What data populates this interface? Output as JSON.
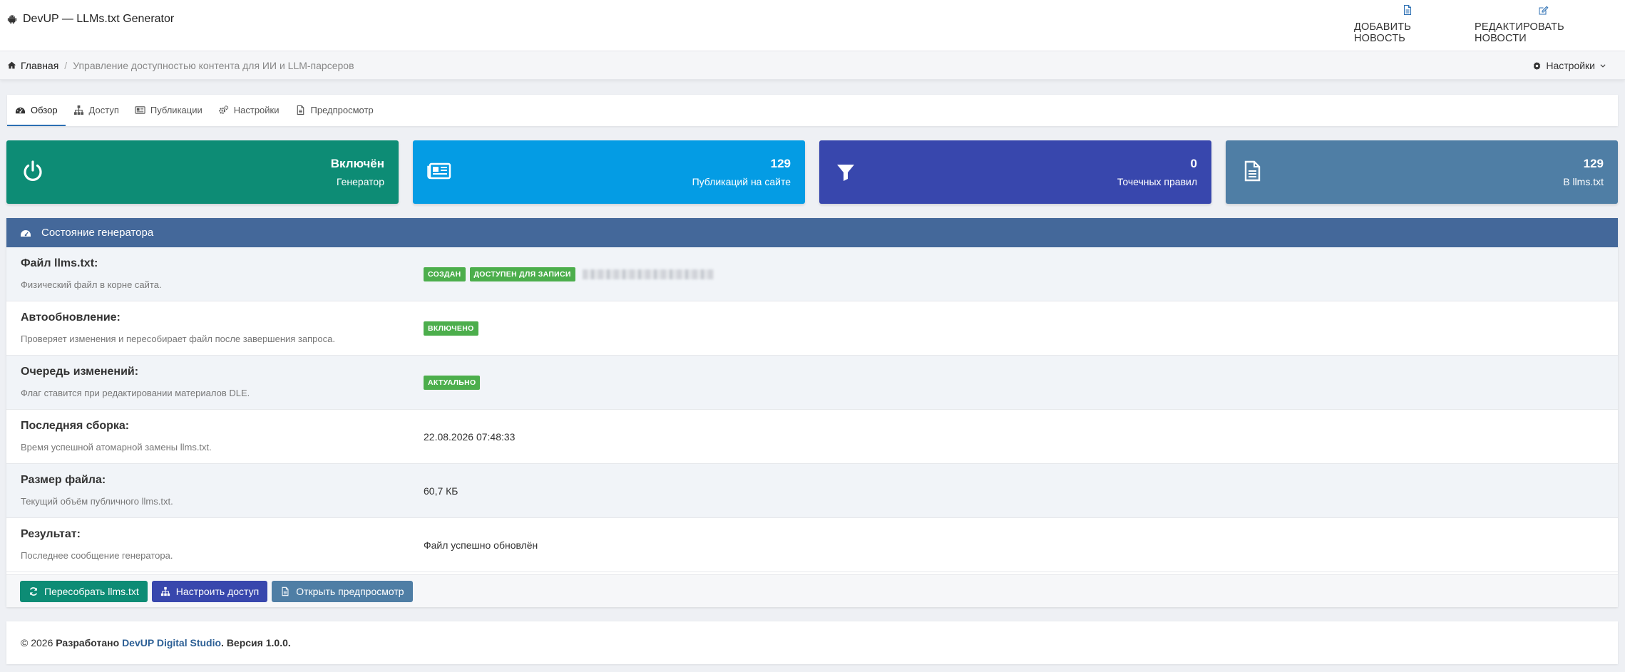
{
  "header": {
    "title": "DevUP — LLMs.txt Generator",
    "add_news": "Добавить новость",
    "edit_news": "Редактировать новости"
  },
  "breadcrumbs": {
    "home": "Главная",
    "separator": "/",
    "current": "Управление доступностью контента для ИИ и LLM-парсеров",
    "settings": "Настройки"
  },
  "tabs": [
    {
      "label": "Обзор",
      "icon": "dashboard-icon",
      "active": true
    },
    {
      "label": "Доступ",
      "icon": "sitemap-icon"
    },
    {
      "label": "Публикации",
      "icon": "newspaper-icon"
    },
    {
      "label": "Настройки",
      "icon": "cogs-icon"
    },
    {
      "label": "Предпросмотр",
      "icon": "file-icon"
    }
  ],
  "stats": [
    {
      "value": "Включён",
      "label": "Генератор",
      "icon": "power-icon",
      "color": "#0d8c75"
    },
    {
      "value": "129",
      "label": "Публикаций на сайте",
      "icon": "newspaper-icon",
      "color": "#049ce4"
    },
    {
      "value": "0",
      "label": "Точечных правил",
      "icon": "filter-icon",
      "color": "#3847ad"
    },
    {
      "value": "129",
      "label": "В llms.txt",
      "icon": "file-icon",
      "color": "#4f7ea5"
    }
  ],
  "panel": {
    "title": "Состояние генератора",
    "rows": [
      {
        "title": "Файл llms.txt:",
        "desc": "Физический файл в корне сайта.",
        "badges": [
          "Создан",
          "Доступен для записи"
        ]
      },
      {
        "title": "Автообновление:",
        "desc": "Проверяет изменения и пересобирает файл после завершения запроса.",
        "badges": [
          "Включено"
        ]
      },
      {
        "title": "Очередь изменений:",
        "desc": "Флаг ставится при редактировании материалов DLE.",
        "badges": [
          "Актуально"
        ]
      },
      {
        "title": "Последняя сборка:",
        "desc": "Время успешной атомарной замены llms.txt.",
        "value": "22.08.2026 07:48:33"
      },
      {
        "title": "Размер файла:",
        "desc": "Текущий объём публичного llms.txt.",
        "value": "60,7 КБ"
      },
      {
        "title": "Результат:",
        "desc": "Последнее сообщение генератора.",
        "value": "Файл успешно обновлён"
      }
    ],
    "buttons": {
      "rebuild": "Пересобрать llms.txt",
      "access": "Настроить доступ",
      "preview": "Открыть предпросмотр"
    }
  },
  "footer": {
    "copyright": "© 2026",
    "developed": "Разработано",
    "studio": "DevUP Digital Studio",
    "version": ". Версия 1.0.0."
  },
  "colors": {
    "accent_green": "#0d8c75",
    "accent_blue": "#049ce4",
    "accent_indigo": "#3847ad",
    "accent_steel": "#4f7ea5",
    "panel_header": "#44689a",
    "badge_green": "#4cae4c"
  }
}
